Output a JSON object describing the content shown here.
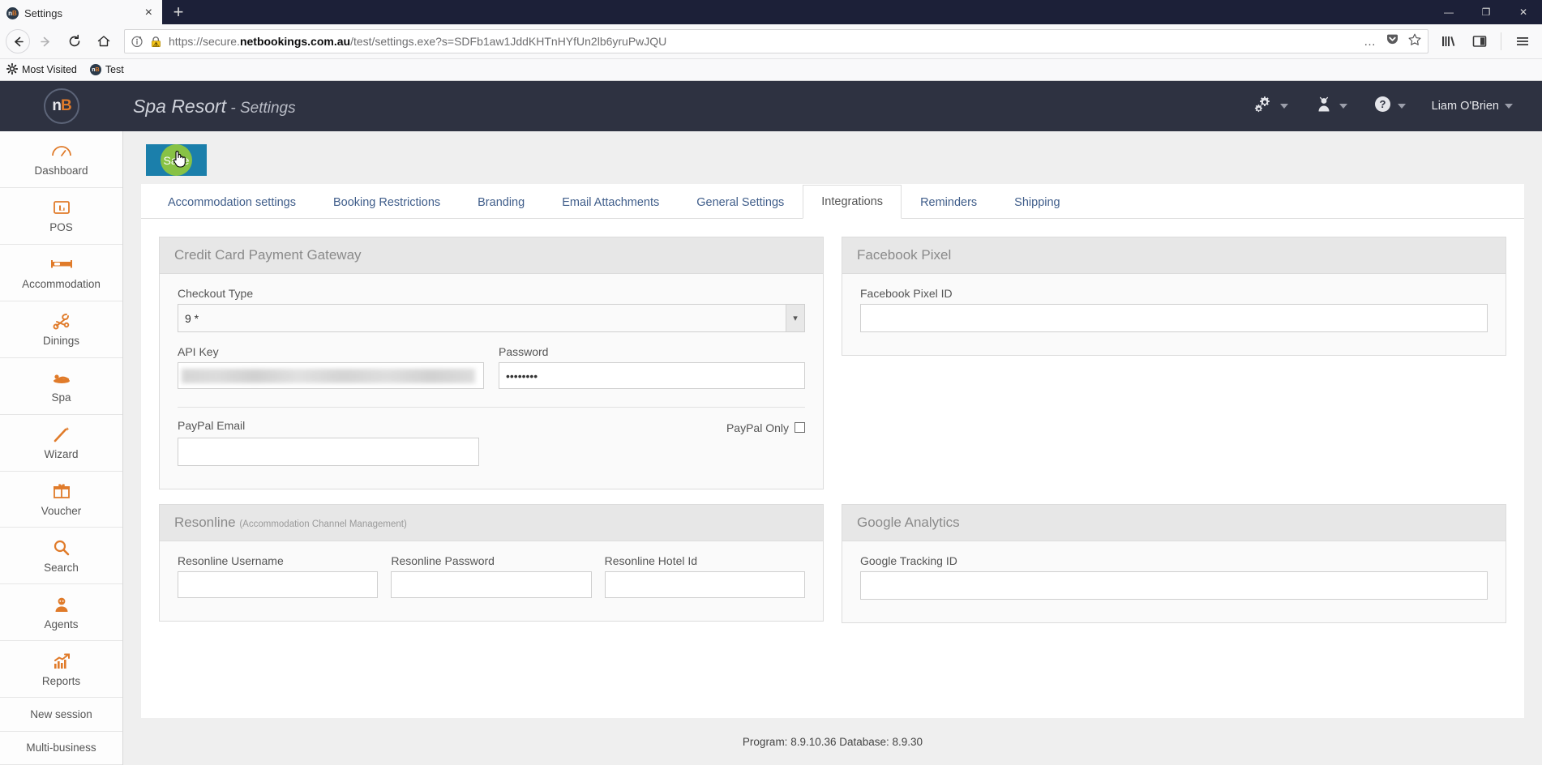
{
  "browser": {
    "tab": {
      "title": "Settings",
      "favicon": "nb-logo-icon",
      "close": "×"
    },
    "newtab_label": "+",
    "window_controls": {
      "minimize": "—",
      "maximize": "❐",
      "close": "✕"
    },
    "nav": {
      "back": "←",
      "forward": "→",
      "reload": "↻",
      "home": "⌂"
    },
    "url": {
      "prefix": "https://secure.",
      "domain": "netbookings.com.au",
      "suffix": "/test/settings.exe?s=SDFb1aw1JddKHTnHYfUn2lb6yruPwJQU",
      "full": "https://secure.netbookings.com.au/test/settings.exe?s=SDFb1aw1JddKHTnHYfUn2lb6yruPwJQU",
      "info_icon": "info-icon",
      "warning_icon": "insecure-warning-icon",
      "page_actions": "…",
      "pocket_icon": "pocket-icon",
      "bookmark_icon": "star-icon"
    },
    "toolbar": {
      "library_icon": "library-icon",
      "sidebar_icon": "sidebar-icon",
      "menu_icon": "hamburger-menu-icon"
    },
    "bookmarks": [
      {
        "label": "Most Visited",
        "icon": "most-visited-icon"
      },
      {
        "label": "Test",
        "icon": "nb-logo-icon"
      }
    ]
  },
  "app": {
    "logo": {
      "n": "n",
      "b": "B"
    },
    "title_main": "Spa Resort",
    "title_sep": " - ",
    "title_sub": "Settings",
    "header_icons": [
      {
        "name": "settings-gear-icon",
        "label": ""
      },
      {
        "name": "user-staff-icon",
        "label": ""
      },
      {
        "name": "help-question-icon",
        "label": ""
      }
    ],
    "user_name": "Liam O'Brien"
  },
  "sidebar": {
    "items": [
      {
        "label": "Dashboard",
        "icon": "dashboard-gauge-icon"
      },
      {
        "label": "POS",
        "icon": "pos-register-icon"
      },
      {
        "label": "Accommodation",
        "icon": "bed-icon"
      },
      {
        "label": "Dinings",
        "icon": "dining-cutlery-icon"
      },
      {
        "label": "Spa",
        "icon": "spa-massage-icon"
      },
      {
        "label": "Wizard",
        "icon": "magic-wand-icon"
      },
      {
        "label": "Voucher",
        "icon": "gift-voucher-icon"
      },
      {
        "label": "Search",
        "icon": "search-magnifier-icon"
      },
      {
        "label": "Agents",
        "icon": "agent-person-icon"
      },
      {
        "label": "Reports",
        "icon": "reports-chart-icon"
      }
    ],
    "plain_items": [
      {
        "label": "New session"
      },
      {
        "label": "Multi-business"
      }
    ]
  },
  "toolbar": {
    "save_label": "Save"
  },
  "tabs": [
    {
      "label": "Accommodation settings",
      "active": false
    },
    {
      "label": "Booking Restrictions",
      "active": false
    },
    {
      "label": "Branding",
      "active": false
    },
    {
      "label": "Email Attachments",
      "active": false
    },
    {
      "label": "General Settings",
      "active": false
    },
    {
      "label": "Integrations",
      "active": true
    },
    {
      "label": "Reminders",
      "active": false
    },
    {
      "label": "Shipping",
      "active": false
    }
  ],
  "panels": {
    "credit_card": {
      "title": "Credit Card Payment Gateway",
      "checkout_type_label": "Checkout Type",
      "checkout_type_value": "9 *",
      "api_key_label": "API Key",
      "api_key_value": "",
      "password_label": "Password",
      "password_value": "••••••••",
      "paypal_email_label": "PayPal Email",
      "paypal_email_value": "",
      "paypal_only_label": "PayPal Only",
      "paypal_only_checked": false
    },
    "facebook": {
      "title": "Facebook Pixel",
      "pixel_id_label": "Facebook Pixel ID",
      "pixel_id_value": ""
    },
    "resonline": {
      "title": "Resonline",
      "subtitle": "(Accommodation Channel Management)",
      "username_label": "Resonline Username",
      "username_value": "",
      "password_label": "Resonline Password",
      "password_value": "",
      "hotel_id_label": "Resonline Hotel Id",
      "hotel_id_value": ""
    },
    "google": {
      "title": "Google Analytics",
      "tracking_id_label": "Google Tracking ID",
      "tracking_id_value": ""
    }
  },
  "footer": {
    "version_text": "Program: 8.9.10.36 Database: 8.9.30"
  },
  "colors": {
    "header_bg": "#2e3241",
    "accent_orange": "#e07b2a",
    "save_blue": "#1b7fab",
    "save_green": "#8ec63f",
    "tab_link": "#3f5d8a"
  }
}
